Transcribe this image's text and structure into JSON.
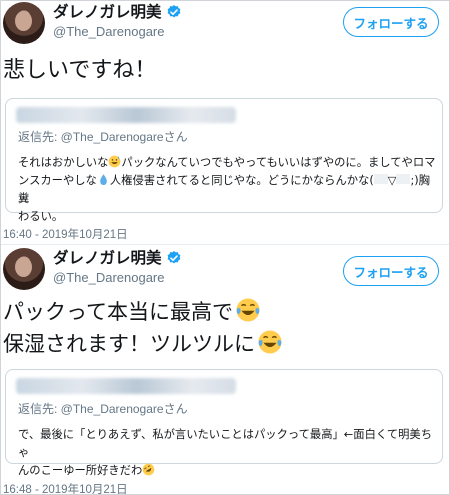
{
  "tweets": [
    {
      "display_name": "ダレノガレ明美",
      "handle": "@The_Darenogare",
      "follow_label": "フォローする",
      "text": "悲しいですね！",
      "quote": {
        "reply_to": "返信先: @The_Darenogareさん",
        "line1_a": "それはおかしいな",
        "line1_b": "パックなんていつでもやってもいいはずやのに。ましてやロマ",
        "line2_a": "ンスカーやしな",
        "line2_b": "人権侵害されてると同じやな。どうにかならんかな(",
        "line2_c": "▽",
        "line2_d": ";)胸糞",
        "line3": "わるい。"
      },
      "timestamp": "16:40 - 2019年10月21日"
    },
    {
      "display_name": "ダレノガレ明美",
      "handle": "@The_Darenogare",
      "follow_label": "フォローする",
      "text_line1": "パックって本当に最高で",
      "text_line2": "保湿されます！ツルツルに",
      "quote": {
        "reply_to": "返信先: @The_Darenogareさん",
        "line1": "で、最後に「とりあえず、私が言いたいことはパックって最高」←面白くて明美ちゃ",
        "line2": "んのこーゆー所好きだわ"
      },
      "timestamp": "16:48 - 2019年10月21日"
    }
  ],
  "icons": {
    "verified": "verified-badge-icon",
    "tears_of_joy": "face-with-tears-of-joy-icon",
    "sweat_smile": "grinning-face-with-sweat-icon",
    "droplet": "droplet-icon",
    "rofl": "rolling-on-floor-laughing-icon"
  },
  "colors": {
    "accent": "#1da1f2",
    "text": "#14171a",
    "muted": "#657786",
    "border": "#ccd6dd"
  }
}
